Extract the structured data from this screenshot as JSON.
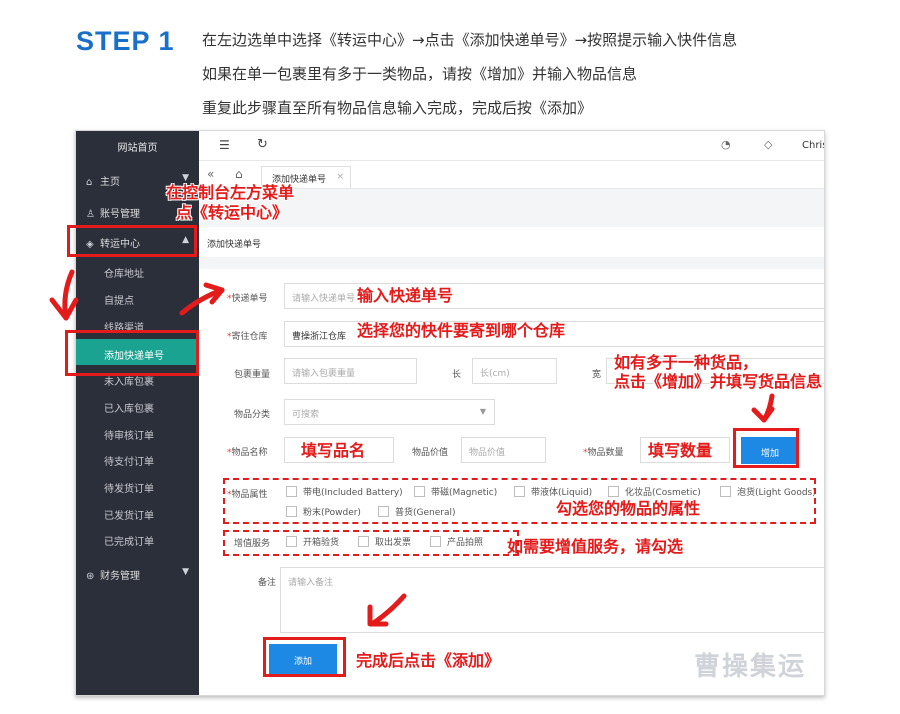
{
  "step": {
    "label": "STEP 1",
    "lines": [
      "在左边选单中选择《转运中心》→点击《添加快递单号》→按照提示输入快件信息",
      "如果在单一包裹里有多于一类物品，请按《增加》并输入物品信息",
      "重复此步骤直至所有物品信息输入完成，完成后按《添加》"
    ]
  },
  "sidebar": {
    "home": "网站首页",
    "items": [
      {
        "label": "主页"
      },
      {
        "label": "账号管理"
      },
      {
        "label": "转运中心"
      },
      {
        "label": "财务管理"
      }
    ],
    "sub_items": [
      "仓库地址",
      "自提点",
      "线路渠道",
      "添加快递单号",
      "未入库包裹",
      "已入库包裹",
      "待审核订单",
      "待支付订单",
      "待发货订单",
      "已发货订单",
      "已完成订单"
    ]
  },
  "topbar": {
    "user": "Chris"
  },
  "tabs": {
    "active_tab": "添加快递单号"
  },
  "breadcrumb": "添加快递单号",
  "form": {
    "tracking": {
      "label": "快递单号",
      "placeholder": "请输入快递单号"
    },
    "warehouse": {
      "label": "寄往仓库",
      "value": "曹操浙江仓库"
    },
    "weight": {
      "label": "包裹重量",
      "placeholder": "请输入包裹重量"
    },
    "length": {
      "label": "长",
      "placeholder": "长(cm)"
    },
    "width": {
      "label": "宽"
    },
    "category": {
      "label": "物品分类",
      "placeholder": "可搜索"
    },
    "name": {
      "label": "物品名称"
    },
    "value": {
      "label": "物品价值",
      "placeholder": "物品价值"
    },
    "qty": {
      "label": "物品数量"
    },
    "add_item_button": "增加",
    "attributes_label": "物品属性",
    "attributes": [
      "带电(Included Battery)",
      "带磁(Magnetic)",
      "带液体(Liquid)",
      "化妆品(Cosmetic)",
      "泡货(Light Goods)",
      "粉末(Powder)",
      "普货(General)"
    ],
    "services_label": "增值服务",
    "services": [
      "开箱验货",
      "取出发票",
      "产品拍照"
    ],
    "remark": {
      "label": "备注",
      "placeholder": "请输入备注"
    },
    "submit_button": "添加"
  },
  "annotations": {
    "sidebar_hint_1": "在控制台左方菜单",
    "sidebar_hint_2": "点《转运中心》",
    "tracking_hint": "输入快递单号",
    "warehouse_hint": "选择您的快件要寄到哪个仓库",
    "add_hint_1": "如有多于一种货品，",
    "add_hint_2": "点击《增加》并填写货品信息",
    "name_hint": "填写品名",
    "qty_hint": "填写数量",
    "attr_hint": "勾选您的物品的属性",
    "service_hint": "如需要增值服务，请勾选",
    "submit_hint": "完成后点击《添加》"
  },
  "watermark": "曹操集运",
  "colors": {
    "accent": "#1e88e5",
    "sidebar": "#2b2f3a",
    "active": "#1aa391",
    "annotation": "#e31b1b"
  }
}
